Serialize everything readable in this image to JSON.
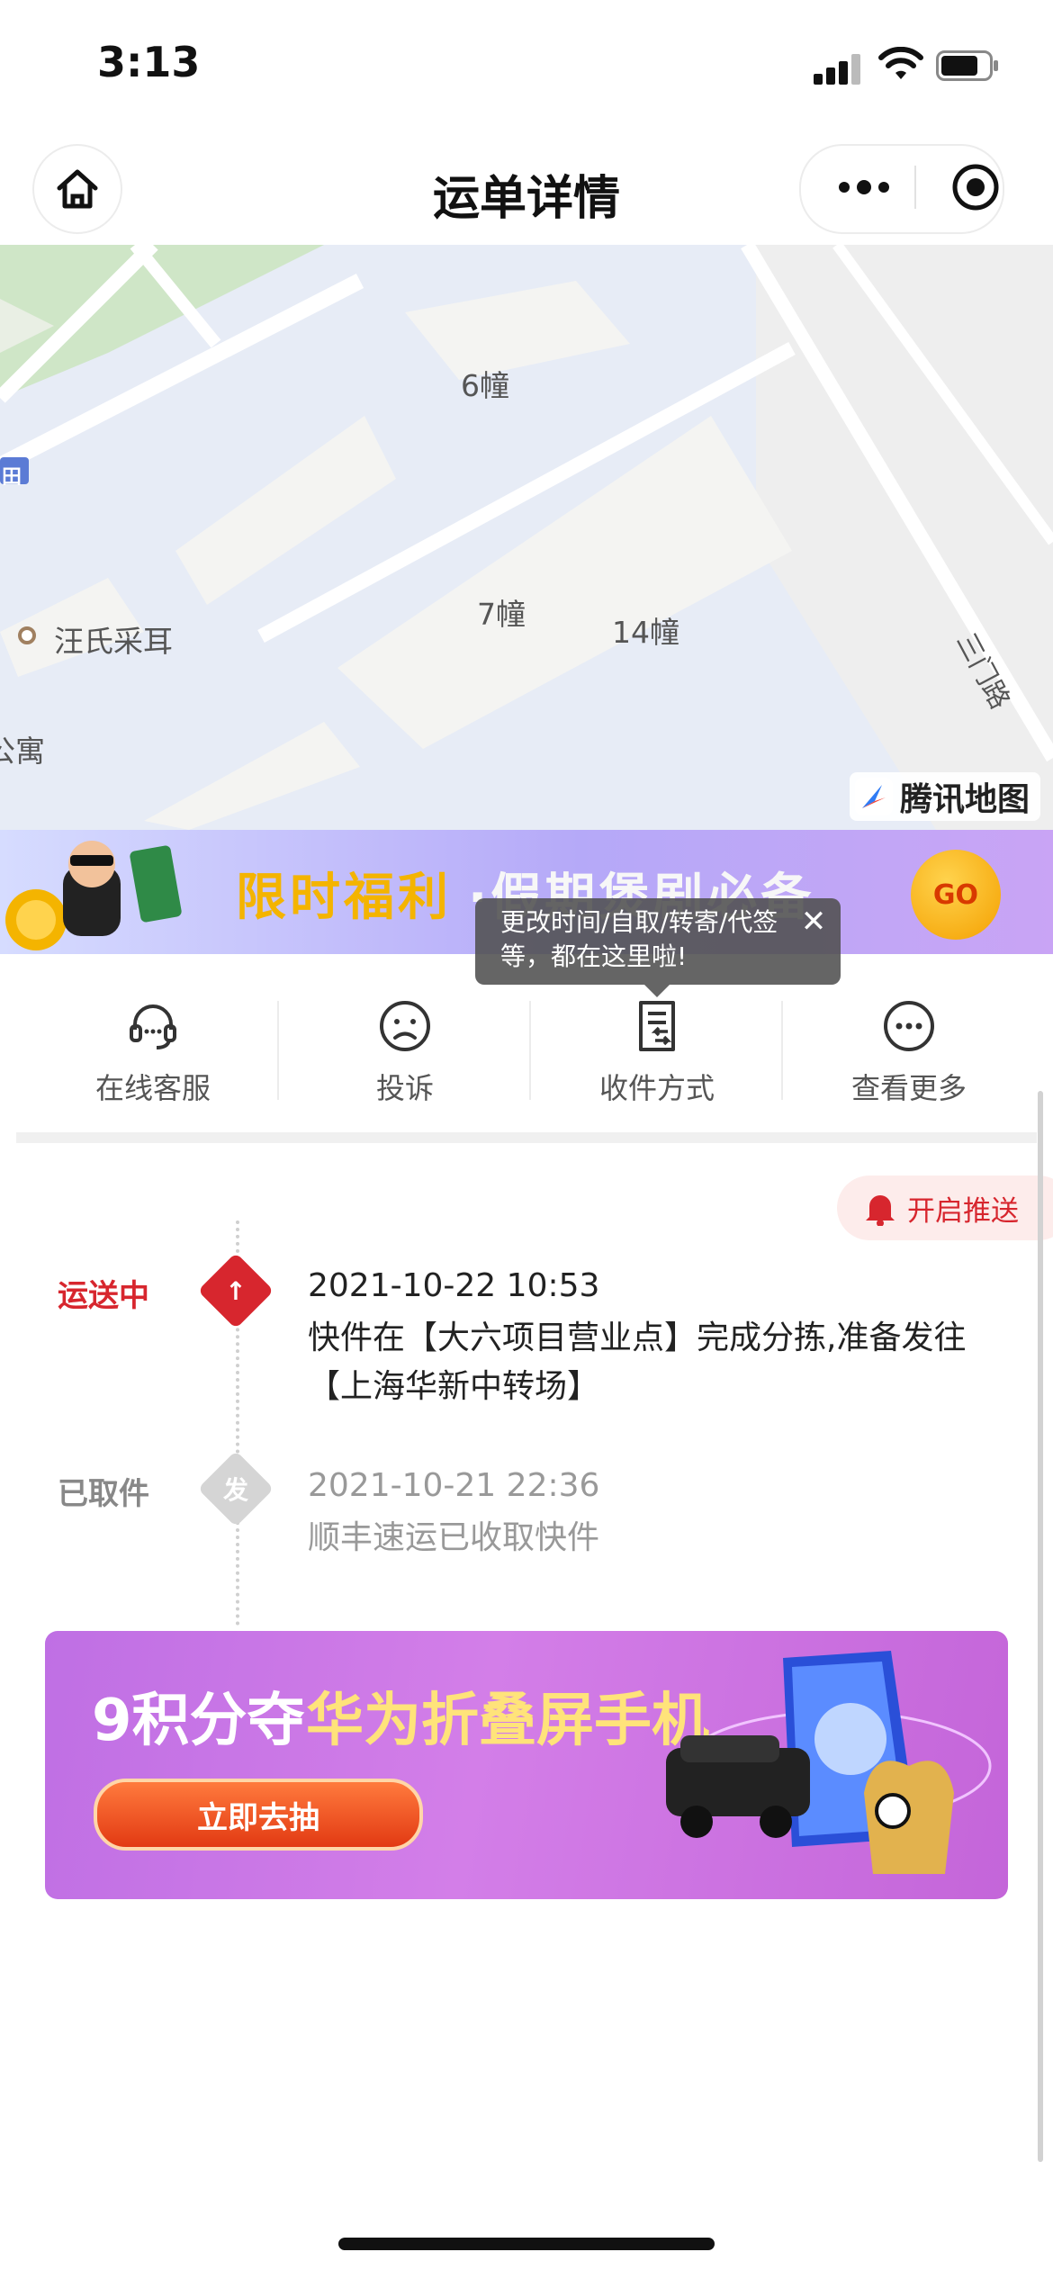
{
  "status_bar": {
    "time": "3:13"
  },
  "nav": {
    "title": "运单详情"
  },
  "map": {
    "labels": {
      "building_6": "6幢",
      "building_7": "7幢",
      "building_14": "14幢",
      "poi": "汪氏采耳",
      "apartment": "公寓",
      "road": "三门路",
      "tag": "田"
    },
    "brand": "腾讯地图"
  },
  "promo_banner": {
    "title_highlight": "限时福利",
    "title_rest": "·假期煲剧必备",
    "go_label": "GO"
  },
  "tooltip": {
    "text": "更改时间/自取/转寄/代签等，都在这里啦!",
    "close": "✕"
  },
  "actions": [
    {
      "label": "在线客服",
      "icon": "headset-icon"
    },
    {
      "label": "投诉",
      "icon": "sad-face-icon"
    },
    {
      "label": "收件方式",
      "icon": "receive-method-icon"
    },
    {
      "label": "查看更多",
      "icon": "more-dots-icon"
    }
  ],
  "push": {
    "label": "开启推送"
  },
  "timeline": [
    {
      "status": "运送中",
      "marker": "↑",
      "time": "2021-10-22 10:53",
      "desc": "快件在【大六项目营业点】完成分拣,准备发往【上海华新中转场】",
      "color": "#d7262e"
    },
    {
      "status": "已取件",
      "marker": "发",
      "time": "2021-10-21 22:36",
      "desc": "顺丰速运已收取快件",
      "color": "#999999"
    }
  ],
  "lottery_banner": {
    "title_white": "9积分夺",
    "title_yellow": "华为折叠屏手机",
    "button": "立即去抽"
  }
}
